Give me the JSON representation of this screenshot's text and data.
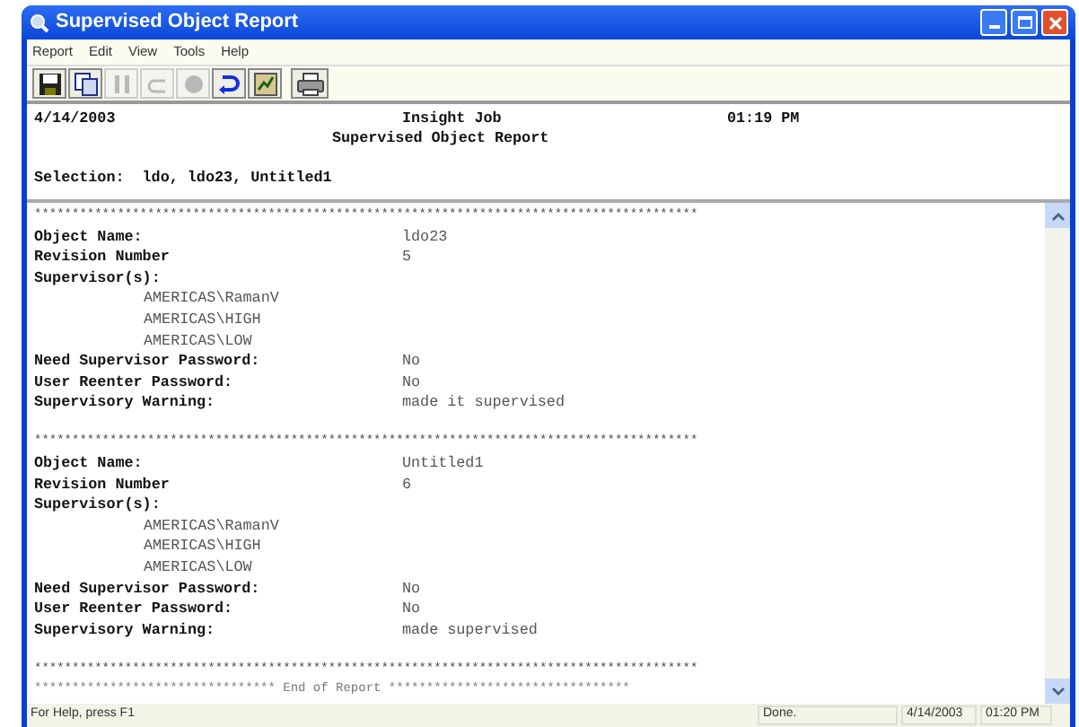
{
  "window": {
    "title": "Supervised Object Report"
  },
  "menu": [
    "Report",
    "Edit",
    "View",
    "Tools",
    "Help"
  ],
  "toolbar": [
    {
      "kind": "save",
      "disabled": false
    },
    {
      "kind": "copy",
      "disabled": false
    },
    {
      "kind": "pause",
      "disabled": true
    },
    {
      "kind": "back",
      "disabled": true
    },
    {
      "kind": "stop",
      "disabled": true
    },
    {
      "kind": "refresh",
      "disabled": false
    },
    {
      "kind": "chart",
      "disabled": false
    },
    {
      "kind": "print",
      "disabled": false
    }
  ],
  "header": {
    "date": "4/14/2003",
    "app": "Insight Job",
    "time": "01:19 PM",
    "title": "Supervised Object Report",
    "selection_label": "Selection:",
    "selection_value": "ldo, ldo23, Untitled1"
  },
  "separator": "****************************************************************************************",
  "records": [
    {
      "lines": [
        {
          "kind": "field",
          "label": "Object Name:",
          "value": "ldo23"
        },
        {
          "kind": "field",
          "label": "Revision Number",
          "value": "5"
        },
        {
          "kind": "heading",
          "label": "Supervisor(s):"
        },
        {
          "kind": "entry",
          "label": "AMERICAS\\RamanV"
        },
        {
          "kind": "entry",
          "label": "AMERICAS\\HIGH"
        },
        {
          "kind": "entry",
          "label": "AMERICAS\\LOW"
        },
        {
          "kind": "field",
          "label": "Need Supervisor Password:",
          "value": "No"
        },
        {
          "kind": "field",
          "label": "User Reenter Password:",
          "value": "No"
        },
        {
          "kind": "field",
          "label": "Supervisory Warning:",
          "value": "made it supervised"
        }
      ]
    },
    {
      "lines": [
        {
          "kind": "field",
          "label": "Object Name:",
          "value": "Untitled1"
        },
        {
          "kind": "field",
          "label": "Revision Number",
          "value": "6"
        },
        {
          "kind": "heading",
          "label": "Supervisor(s):"
        },
        {
          "kind": "entry",
          "label": "AMERICAS\\RamanV"
        },
        {
          "kind": "entry",
          "label": "AMERICAS\\HIGH"
        },
        {
          "kind": "entry",
          "label": "AMERICAS\\LOW"
        },
        {
          "kind": "field",
          "label": "Need Supervisor Password:",
          "value": "No"
        },
        {
          "kind": "field",
          "label": "User Reenter Password:",
          "value": "No"
        },
        {
          "kind": "field",
          "label": "Supervisory Warning:",
          "value": "made supervised"
        }
      ]
    }
  ],
  "footer_separator": "****************************************************************************************",
  "end_line": "******************************** End of Report ********************************",
  "status_bar": {
    "help": "For Help, press F1",
    "state": "Done.",
    "date": "4/14/2003",
    "time": "01:20 PM"
  }
}
